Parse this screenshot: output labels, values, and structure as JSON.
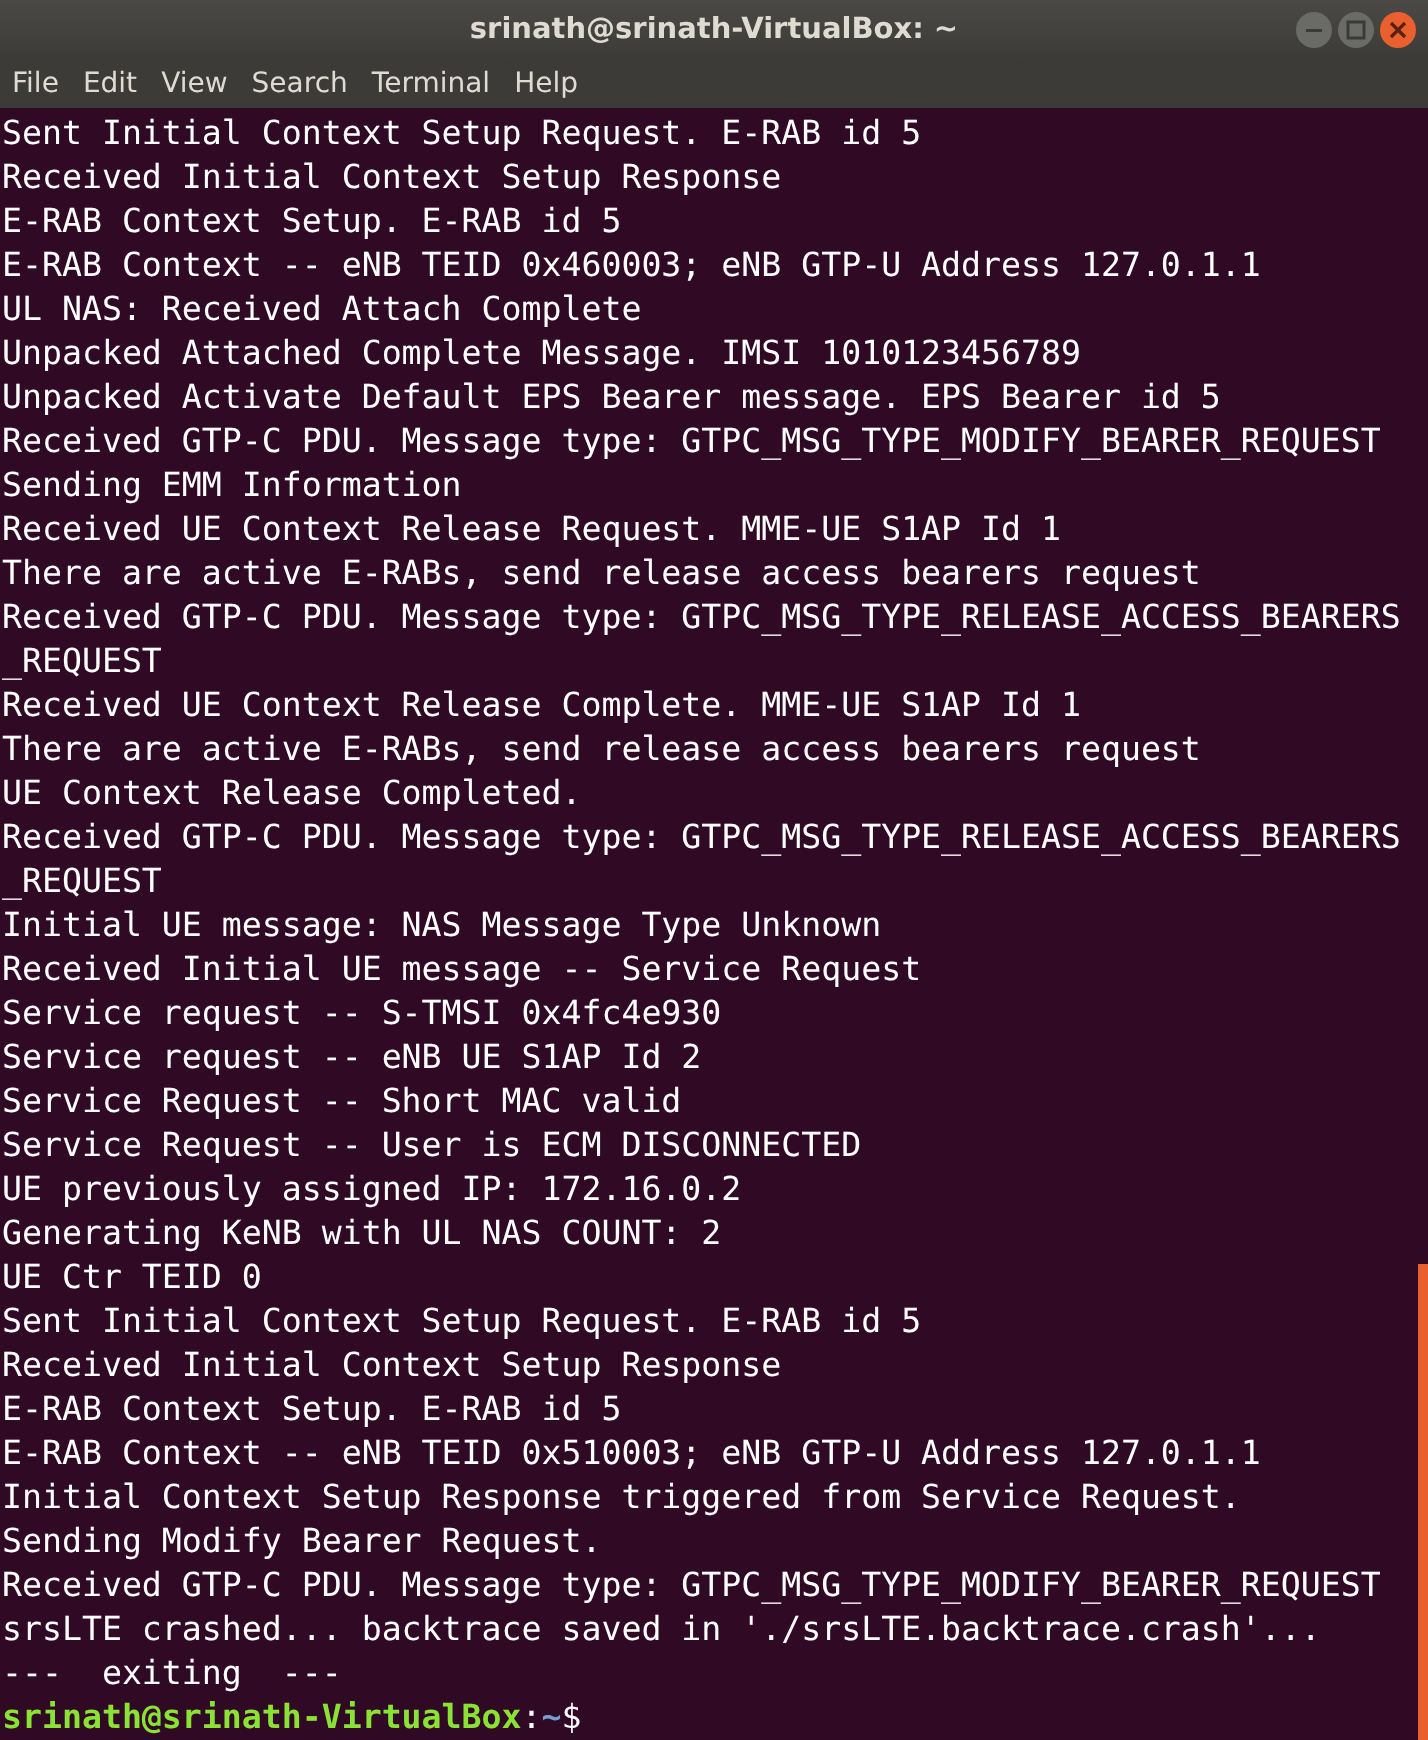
{
  "window": {
    "title": "srinath@srinath-VirtualBox: ~"
  },
  "menu": [
    "File",
    "Edit",
    "View",
    "Search",
    "Terminal",
    "Help"
  ],
  "lines": [
    "Sent Initial Context Setup Request. E-RAB id 5",
    "Received Initial Context Setup Response",
    "E-RAB Context Setup. E-RAB id 5",
    "E-RAB Context -- eNB TEID 0x460003; eNB GTP-U Address 127.0.1.1",
    "UL NAS: Received Attach Complete",
    "Unpacked Attached Complete Message. IMSI 1010123456789",
    "Unpacked Activate Default EPS Bearer message. EPS Bearer id 5",
    "Received GTP-C PDU. Message type: GTPC_MSG_TYPE_MODIFY_BEARER_REQUEST",
    "Sending EMM Information",
    "Received UE Context Release Request. MME-UE S1AP Id 1",
    "There are active E-RABs, send release access bearers request",
    "Received GTP-C PDU. Message type: GTPC_MSG_TYPE_RELEASE_ACCESS_BEARERS",
    "_REQUEST",
    "Received UE Context Release Complete. MME-UE S1AP Id 1",
    "There are active E-RABs, send release access bearers request",
    "UE Context Release Completed.",
    "Received GTP-C PDU. Message type: GTPC_MSG_TYPE_RELEASE_ACCESS_BEARERS",
    "_REQUEST",
    "Initial UE message: NAS Message Type Unknown",
    "Received Initial UE message -- Service Request",
    "Service request -- S-TMSI 0x4fc4e930",
    "Service request -- eNB UE S1AP Id 2",
    "Service Request -- Short MAC valid",
    "Service Request -- User is ECM DISCONNECTED",
    "UE previously assigned IP: 172.16.0.2",
    "Generating KeNB with UL NAS COUNT: 2",
    "UE Ctr TEID 0",
    "Sent Initial Context Setup Request. E-RAB id 5",
    "Received Initial Context Setup Response",
    "E-RAB Context Setup. E-RAB id 5",
    "E-RAB Context -- eNB TEID 0x510003; eNB GTP-U Address 127.0.1.1",
    "Initial Context Setup Response triggered from Service Request.",
    "Sending Modify Bearer Request.",
    "Received GTP-C PDU. Message type: GTPC_MSG_TYPE_MODIFY_BEARER_REQUEST",
    "srsLTE crashed... backtrace saved in './srsLTE.backtrace.crash'...",
    "---  exiting  ---"
  ],
  "prompt": {
    "user_host": "srinath@srinath-VirtualBox",
    "separator": ":",
    "path": "~",
    "symbol": "$"
  }
}
